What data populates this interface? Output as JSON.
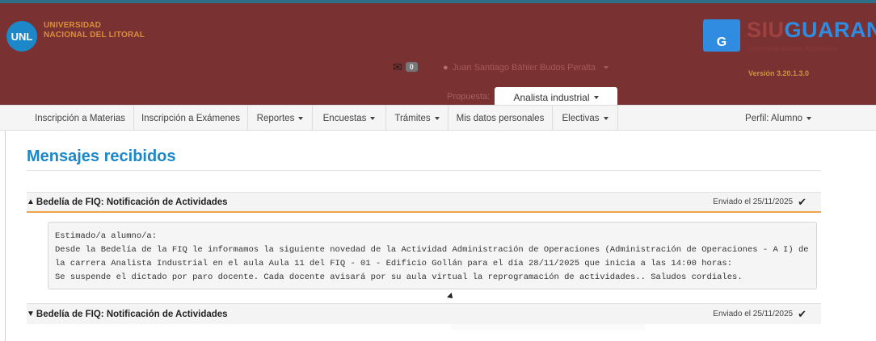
{
  "header": {
    "logo_text": "UNL",
    "university_line1": "UNIVERSIDAD",
    "university_line2": "NACIONAL DEL LITORAL",
    "mail_count": "0",
    "user_name": "Juan Santiago Bähler Budos Peralta",
    "propuesta_label": "Propuesta:",
    "propuesta_value": "Analista industrial",
    "siu_logo_letter": "G",
    "siu_text_part1": "SIU",
    "siu_text_part2": "GUARAN",
    "siu_subtitle": "Sistema de Gestión Académica",
    "version": "Versión 3.20.1.3.0"
  },
  "nav": {
    "items": [
      {
        "label": "Inscripción a Materias",
        "dropdown": false
      },
      {
        "label": "Inscripción a Exámenes",
        "dropdown": false
      },
      {
        "label": "Reportes",
        "dropdown": true
      },
      {
        "label": "Encuestas",
        "dropdown": true
      },
      {
        "label": "Trámites",
        "dropdown": true
      },
      {
        "label": "Mis datos personales",
        "dropdown": false
      },
      {
        "label": "Electivas",
        "dropdown": true
      }
    ],
    "profile": "Perfil: Alumno"
  },
  "page_title": "Mensajes recibidos",
  "messages": [
    {
      "title": "Bedelía de FIQ: Notificación de Actividades",
      "date": "Enviado el 25/11/2025",
      "expanded": true,
      "body": "Estimado/a alumno/a:\nDesde la Bedelía de la FIQ le informamos la siguiente novedad de la Actividad Administración de Operaciones (Administración de Operaciones - A I) de la carrera Analista Industrial en el aula Aula 11 del FIQ - 01 - Edificio Gollán para el día 28/11/2025 que inicia a las 14:00 horas:\nSe suspende el dictado por paro docente. Cada docente avisará por su aula virtual la reprogramación de actividades.. Saludos cordiales."
    },
    {
      "title": "Bedelía de FIQ: Notificación de Actividades",
      "date": "Enviado el 25/11/2025",
      "expanded": false
    }
  ],
  "tooltip": "Bedelía de FIQ: Notificación de Actividades",
  "icons": {
    "mail": "envelope-icon",
    "user": "user-icon",
    "check": "check-icon",
    "chevron_up": "chevron-up-icon",
    "chevron_down": "chevron-down-icon"
  },
  "colors": {
    "header_bg": "#7a3131",
    "accent_blue": "#1c87c9",
    "accent_orange": "#f0a44a"
  }
}
